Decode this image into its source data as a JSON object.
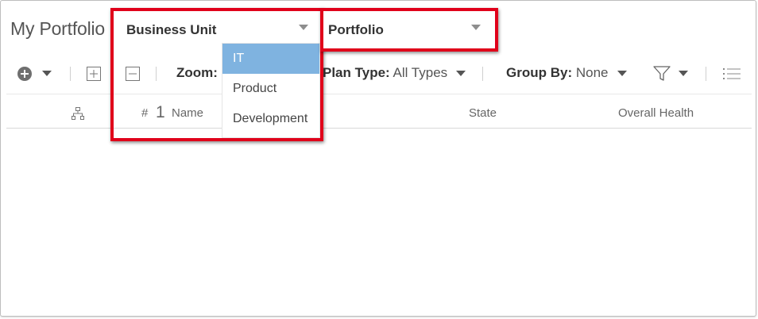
{
  "page": {
    "title": "My Portfolio"
  },
  "filters": {
    "business_unit": {
      "label": "Business Unit",
      "options": [
        "IT",
        "Product",
        "Development"
      ],
      "highlighted": "IT"
    },
    "portfolio": {
      "label": "Portfolio"
    }
  },
  "toolbar": {
    "zoom_label": "Zoom:",
    "plan_type_label": "Plan Type:",
    "plan_type_value": "All Types",
    "group_by_label": "Group By:",
    "group_by_value": "None"
  },
  "table": {
    "columns": {
      "number": "#",
      "sort_indicator": "1",
      "name": "Name",
      "state": "State",
      "health": "Overall Health"
    }
  },
  "colors": {
    "highlight_border": "#e0001a",
    "selected_option_bg": "#7fb3e0"
  },
  "icons": [
    "add-circle-icon",
    "expand-all-icon",
    "collapse-all-icon",
    "filter-icon",
    "list-icon",
    "hierarchy-icon"
  ]
}
